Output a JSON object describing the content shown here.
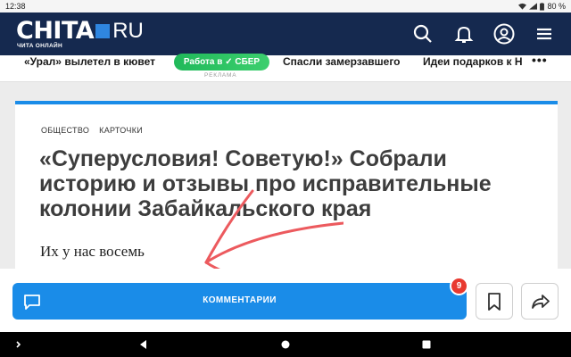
{
  "status_bar": {
    "time": "12:38",
    "battery": "80 %"
  },
  "header": {
    "logo_main": "CHITA",
    "logo_domain": "RU",
    "logo_sub": "ЧИТА ОНЛАЙН",
    "icons": [
      "search-icon",
      "bell-icon",
      "user-icon",
      "menu-icon"
    ]
  },
  "ticker": {
    "items": [
      "«Урал» вылетел в кювет",
      "Спасли замерзавшего",
      "Идеи подарков к Н"
    ],
    "ad_badge": "Работа в ✓ СБЕР",
    "ad_caption": "РЕКЛАМА",
    "more": "•••"
  },
  "article": {
    "rubrics": [
      "ОБЩЕСТВО",
      "КАРТОЧКИ"
    ],
    "title": "«Суперусловия! Советую!» Собрали историю и отзывы про исправительные колонии Забайкальского края",
    "lead": "Их у нас восемь"
  },
  "actions": {
    "comments_label": "КОММЕНТАРИИ",
    "comments_count": "9"
  },
  "colors": {
    "header_bg": "#15294f",
    "accent": "#1a8ce8",
    "badge": "#e8392f",
    "ad_green": "#20b95a",
    "annotation_arrow": "#ec5a5e"
  }
}
